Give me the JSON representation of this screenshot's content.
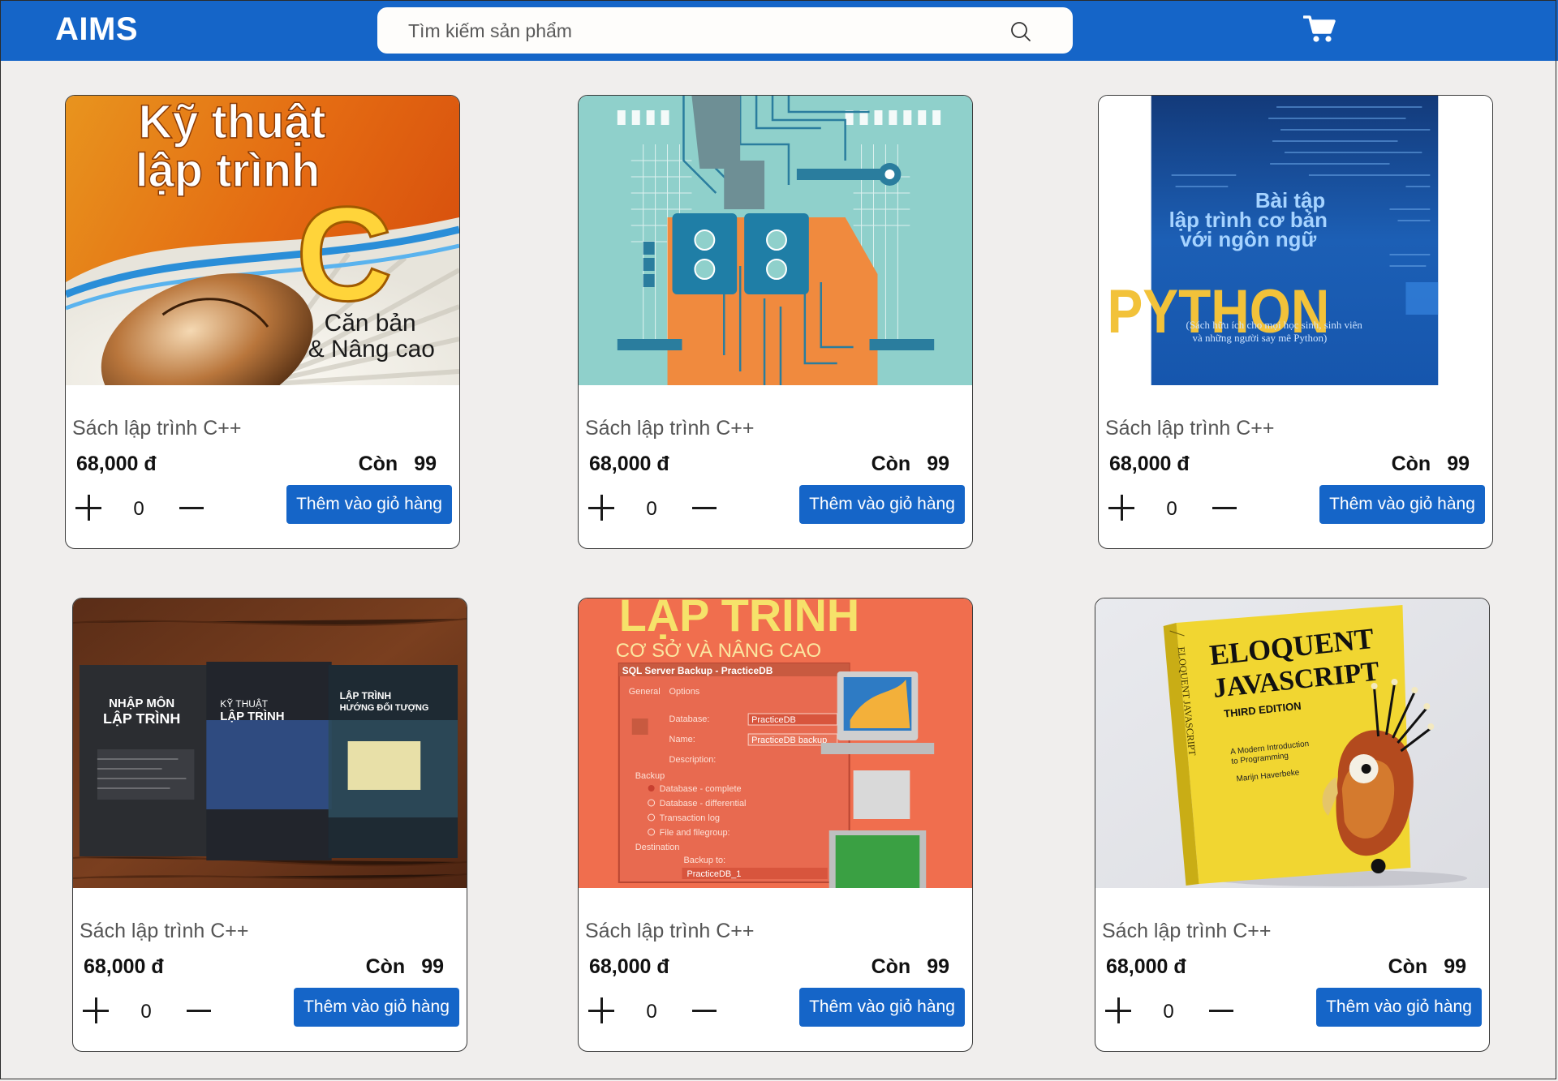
{
  "header": {
    "logo": "AIMS",
    "search_placeholder": "Tìm kiếm sản phẩm",
    "colors": {
      "bar": "#1565c8",
      "page_bg": "#f0eeed"
    }
  },
  "products": [
    {
      "title": "Sách lập trình C++",
      "price": "68,000 đ",
      "stock_label": "Còn",
      "stock": "99",
      "quantity": "0",
      "add_label": "Thêm vào giỏ hàng",
      "cover": {
        "line1": "Kỹ thuật",
        "line2": "lập trình",
        "letter": "C",
        "sub1": "Căn bản",
        "sub2": "& Nâng cao"
      }
    },
    {
      "title": "Sách lập trình C++",
      "price": "68,000 đ",
      "stock_label": "Còn",
      "stock": "99",
      "quantity": "0",
      "add_label": "Thêm vào giỏ hàng"
    },
    {
      "title": "Sách lập trình C++",
      "price": "68,000 đ",
      "stock_label": "Còn",
      "stock": "99",
      "quantity": "0",
      "add_label": "Thêm vào giỏ hàng",
      "cover": {
        "line1": "Bài tập",
        "line2": "lập trình cơ bản",
        "line3": "với ngôn ngữ",
        "big": "PYTHON",
        "note1": "(Sách hữu ích cho mọi học sinh, sinh viên",
        "note2": "và những người say mê Python)"
      }
    },
    {
      "title": "Sách lập trình C++",
      "price": "68,000 đ",
      "stock_label": "Còn",
      "stock": "99",
      "quantity": "0",
      "add_label": "Thêm vào giỏ hàng",
      "cover": {
        "book1a": "NHẬP MÔN",
        "book1b": "LẬP TRÌNH",
        "book2a": "KỸ THUẬT",
        "book2b": "LẬP TRÌNH",
        "book3a": "LẬP TRÌNH",
        "book3b": "HƯỚNG ĐỐI TƯỢNG"
      }
    },
    {
      "title": "Sách lập trình C++",
      "price": "68,000 đ",
      "stock_label": "Còn",
      "stock": "99",
      "quantity": "0",
      "add_label": "Thêm vào giỏ hàng",
      "cover": {
        "line1": "LẬP TRÌNH",
        "line2": "CƠ SỞ VÀ NÂNG CAO",
        "window_title": "SQL Server Backup - PracticeDB",
        "tab1": "General",
        "tab2": "Options",
        "f_database": "Database:",
        "v_database": "PracticeDB",
        "f_name": "Name:",
        "v_name": "PracticeDB backup",
        "f_desc": "Description:",
        "backup": "Backup",
        "opt1": "Database - complete",
        "opt2": "Database - differential",
        "opt3": "Transaction log",
        "opt4": "File and filegroup:",
        "destination": "Destination",
        "backup_to": "Backup to:",
        "dest_value": "PracticeDB_1"
      }
    },
    {
      "title": "Sách lập trình C++",
      "price": "68,000 đ",
      "stock_label": "Còn",
      "stock": "99",
      "quantity": "0",
      "add_label": "Thêm vào giỏ hàng",
      "cover": {
        "line1": "ELOQUENT",
        "line2": "JAVASCRIPT",
        "edition": "THIRD EDITION",
        "sub1": "A Modern Introduction",
        "sub2": "to Programming",
        "author": "Marijn Haverbeke",
        "spine": "ELOQUENT JAVASCRIPT"
      }
    }
  ]
}
